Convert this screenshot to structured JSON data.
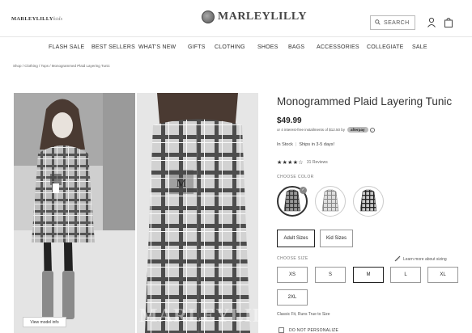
{
  "header": {
    "kids_logo_main": "MARLEYLILLY",
    "kids_logo_suffix": "kids",
    "logo_text": "MARLEYLILLY",
    "search_label": "SEARCH"
  },
  "nav": {
    "items": [
      "FLASH SALE",
      "BEST SELLERS",
      "WHAT'S NEW",
      "GIFTS",
      "CLOTHING",
      "SHOES",
      "BAGS",
      "ACCESSORIES",
      "COLLEGIATE",
      "SALE"
    ]
  },
  "breadcrumb": "Shop / Clothing / Tops / Monogrammed Plaid Layering Tunic",
  "gallery": {
    "view_model_info": "View model info",
    "watermark": "MARLEYLILLY"
  },
  "product": {
    "title": "Monogrammed Plaid Layering Tunic",
    "price": "$49.99",
    "installments_text": "or 4 interest-free installments of $12.50 by",
    "afterpay_label": "afterpay",
    "info_glyph": "i",
    "stock_status": "In Stock",
    "shipping": "Ships in 3-5 days!",
    "stars": "★★★★☆",
    "rating": 4,
    "reviews": "31 Reviews",
    "choose_color_label": "CHOOSE COLOR",
    "color_selected_check": "✓",
    "size_groups": [
      "Adult Sizes",
      "Kid Sizes"
    ],
    "choose_size_label": "CHOOSE SIZE",
    "learn_more": "Learn more about sizing",
    "sizes": [
      "XS",
      "S",
      "M",
      "L",
      "XL",
      "2XL"
    ],
    "selected_size": "M",
    "fit_note": "Classic Fit, Runs True to Size",
    "personalize_label": "DO NOT PERSONALIZE"
  },
  "colors": {
    "accent": "#222222",
    "plaid_dark": "#3a3a3a",
    "plaid_light": "#cfcfcf"
  }
}
